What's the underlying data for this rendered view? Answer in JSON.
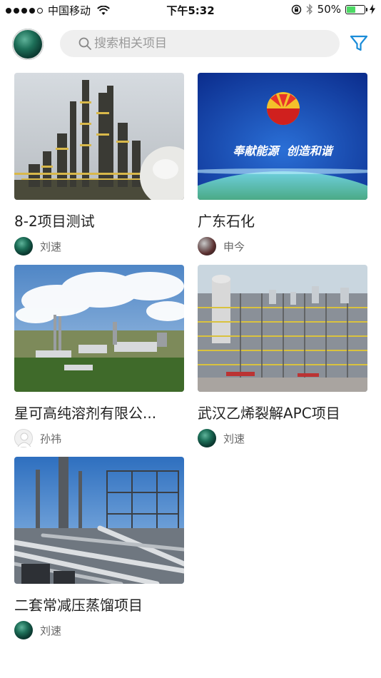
{
  "status_bar": {
    "carrier": "中国移动",
    "time": "下午5:32",
    "battery_text": "50%",
    "battery_level": 0.5
  },
  "header": {
    "search_placeholder": "搜索相关项目"
  },
  "projects": [
    {
      "title": "8-2项目测试",
      "owner": "刘速",
      "image": "refinery-towers"
    },
    {
      "title": "广东石化",
      "owner": "申今",
      "image": "petrochina-logo-banner",
      "banner_text": "奉献能源  创造和谐"
    },
    {
      "title": "星可高纯溶剂有限公...",
      "owner": "孙祎",
      "image": "aerial-plant"
    },
    {
      "title": "武汉乙烯裂解APC项目",
      "owner": "刘速",
      "image": "ethylene-plant"
    },
    {
      "title": "二套常减压蒸馏项目",
      "owner": "刘速",
      "image": "distillation-unit"
    }
  ],
  "colors": {
    "accent": "#1a8cd8",
    "search_bg": "#efefef",
    "battery_green": "#4cd964"
  }
}
